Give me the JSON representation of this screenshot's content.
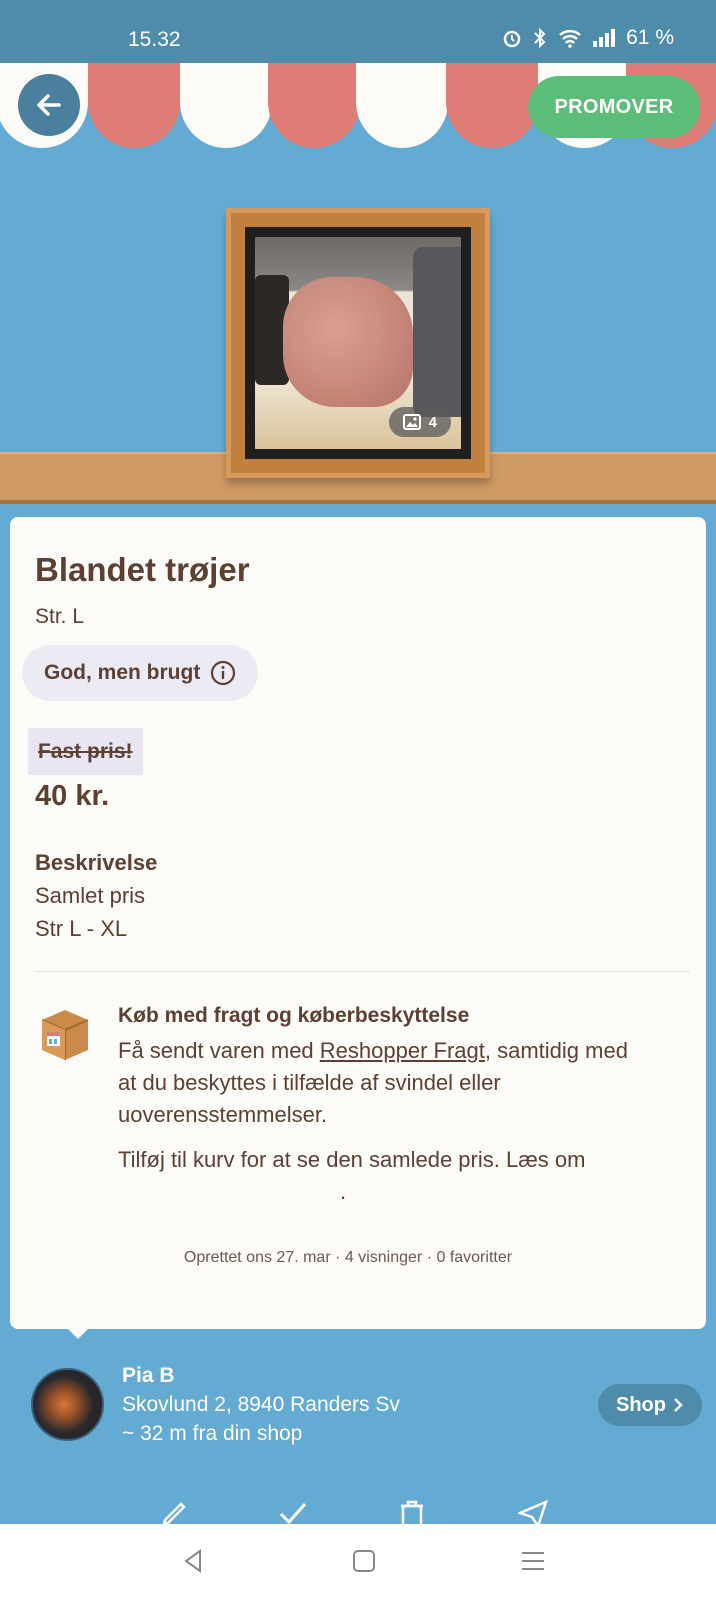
{
  "status_bar": {
    "time": "15.32",
    "battery": "61 %"
  },
  "header": {
    "promote_label": "PROMOVER",
    "photo_count": "4"
  },
  "listing": {
    "title": "Blandet trøjer",
    "size": "Str. L",
    "condition": "God, men brugt",
    "fixed_price_label": "Fast pris!",
    "price": "40 kr.",
    "description_heading": "Beskrivelse",
    "description_lines": [
      "Samlet pris",
      "Str L - XL"
    ]
  },
  "shipping": {
    "heading": "Køb med fragt og køberbeskyttelse",
    "body_prefix": "Få sendt varen med ",
    "link_text": "Reshopper Fragt",
    "body_suffix": ", samtidig med at du beskyttes i tilfælde af svindel eller uoverensstemmelser.",
    "cart_text": "Tilføj til kurv for at se den samlede pris. Læs om",
    "cart_dot": "."
  },
  "meta": "Oprettet ons 27. mar · 4 visninger · 0 favoritter",
  "seller": {
    "name": "Pia B",
    "address": "Skovlund 2, 8940 Randers Sv",
    "distance": "~ 32 m fra din shop",
    "shop_label": "Shop"
  },
  "colors": {
    "background": "#64abd3",
    "status_bar": "#4f8cab",
    "promote": "#5cbc7a",
    "awning_red": "#e07c76",
    "awning_white": "#fcfbf8",
    "shelf": "#d09a66",
    "text": "#5c4033"
  },
  "icons": [
    "back-arrow-icon",
    "info-icon",
    "image-icon",
    "package-icon",
    "chevron-right-icon",
    "edit-icon",
    "check-icon",
    "trash-icon",
    "send-icon",
    "nav-back-icon",
    "nav-home-icon",
    "nav-recents-icon"
  ]
}
